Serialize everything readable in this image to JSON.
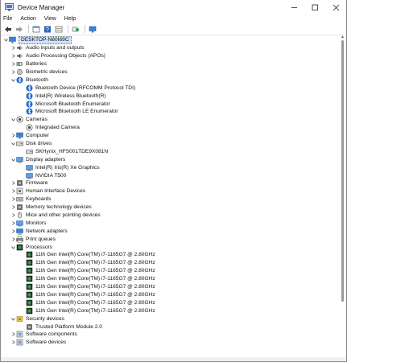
{
  "window": {
    "title": "Device Manager"
  },
  "menu": [
    "File",
    "Action",
    "View",
    "Help"
  ],
  "toolbar": [
    "back-icon",
    "forward-icon",
    "properties-icon",
    "help-icon",
    "view-icon",
    "scan-hardware-icon",
    "monitor-icon"
  ],
  "tree": {
    "root": "DESKTOP-N60I69C",
    "items": [
      {
        "label": "Audio inputs and outputs",
        "icon": "speaker",
        "expanded": false,
        "children": []
      },
      {
        "label": "Audio Processing Objects (APOs)",
        "icon": "speaker",
        "expanded": false,
        "children": []
      },
      {
        "label": "Batteries",
        "icon": "battery",
        "expanded": false,
        "children": []
      },
      {
        "label": "Biometric devices",
        "icon": "fingerprint",
        "expanded": false,
        "children": []
      },
      {
        "label": "Bluetooth",
        "icon": "bluetooth",
        "expanded": true,
        "children": [
          {
            "label": "Bluetooth Device (RFCOMM Protocol TDI)",
            "icon": "bluetooth"
          },
          {
            "label": "Intel(R) Wireless Bluetooth(R)",
            "icon": "bluetooth"
          },
          {
            "label": "Microsoft Bluetooth Enumerator",
            "icon": "bluetooth"
          },
          {
            "label": "Microsoft Bluetooth LE Enumerator",
            "icon": "bluetooth"
          }
        ]
      },
      {
        "label": "Cameras",
        "icon": "camera",
        "expanded": true,
        "children": [
          {
            "label": "Integrated Camera",
            "icon": "camera"
          }
        ]
      },
      {
        "label": "Computer",
        "icon": "monitor",
        "expanded": false,
        "children": []
      },
      {
        "label": "Disk drives",
        "icon": "disk",
        "expanded": true,
        "children": [
          {
            "label": "SKHynix_HFS001TDE9X081N",
            "icon": "disk"
          }
        ]
      },
      {
        "label": "Display adapters",
        "icon": "display",
        "expanded": true,
        "children": [
          {
            "label": "Intel(R) Iris(R) Xe Graphics",
            "icon": "display"
          },
          {
            "label": "NVIDIA T500",
            "icon": "display"
          }
        ]
      },
      {
        "label": "Firmware",
        "icon": "chip",
        "expanded": false,
        "children": []
      },
      {
        "label": "Human Interface Devices",
        "icon": "hid",
        "expanded": false,
        "children": []
      },
      {
        "label": "Keyboards",
        "icon": "keyboard",
        "expanded": false,
        "children": []
      },
      {
        "label": "Memory technology devices",
        "icon": "chip",
        "expanded": false,
        "children": []
      },
      {
        "label": "Mice and other pointing devices",
        "icon": "mouse",
        "expanded": false,
        "children": []
      },
      {
        "label": "Monitors",
        "icon": "display",
        "expanded": false,
        "children": []
      },
      {
        "label": "Network adapters",
        "icon": "network",
        "expanded": false,
        "children": []
      },
      {
        "label": "Print queues",
        "icon": "printer",
        "expanded": false,
        "children": []
      },
      {
        "label": "Processors",
        "icon": "cpu",
        "expanded": true,
        "children": [
          {
            "label": "11th Gen Intel(R) Core(TM) i7-1165G7 @ 2.80GHz",
            "icon": "cpu"
          },
          {
            "label": "11th Gen Intel(R) Core(TM) i7-1165G7 @ 2.80GHz",
            "icon": "cpu"
          },
          {
            "label": "11th Gen Intel(R) Core(TM) i7-1165G7 @ 2.80GHz",
            "icon": "cpu"
          },
          {
            "label": "11th Gen Intel(R) Core(TM) i7-1165G7 @ 2.80GHz",
            "icon": "cpu"
          },
          {
            "label": "11th Gen Intel(R) Core(TM) i7-1165G7 @ 2.80GHz",
            "icon": "cpu"
          },
          {
            "label": "11th Gen Intel(R) Core(TM) i7-1165G7 @ 2.80GHz",
            "icon": "cpu"
          },
          {
            "label": "11th Gen Intel(R) Core(TM) i7-1165G7 @ 2.80GHz",
            "icon": "cpu"
          },
          {
            "label": "11th Gen Intel(R) Core(TM) i7-1165G7 @ 2.80GHz",
            "icon": "cpu"
          }
        ]
      },
      {
        "label": "Security devices",
        "icon": "security",
        "expanded": true,
        "children": [
          {
            "label": "Trusted Platform Module 2.0",
            "icon": "chip"
          }
        ]
      },
      {
        "label": "Software components",
        "icon": "software",
        "expanded": false,
        "children": []
      },
      {
        "label": "Software devices",
        "icon": "software",
        "expanded": false,
        "children": []
      }
    ]
  }
}
